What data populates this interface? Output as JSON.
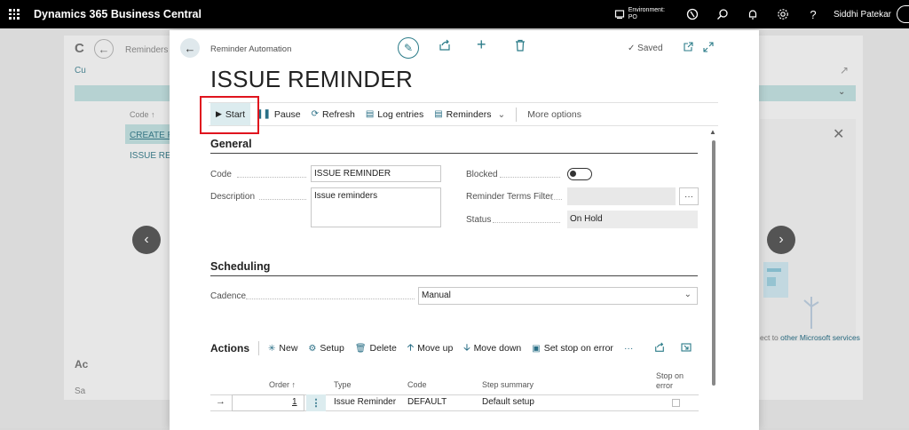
{
  "topbar": {
    "app_title": "Dynamics 365 Business Central",
    "environment_label": "Environment:",
    "environment_value": "PO",
    "user_name": "Siddhi Patekar"
  },
  "background": {
    "breadcrumb": "Reminders A",
    "c_letter": "C",
    "cu_text": "Cu",
    "col_code": "Code ↑",
    "row1": "CREATE RE",
    "row2": "ISSUE REM",
    "side_ac": "Ac",
    "side_sa": "Sa",
    "link_prefix": "ect to",
    "link_text": "other Microsoft services"
  },
  "dialog": {
    "breadcrumb": "Reminder Automation",
    "saved": "Saved",
    "title": "ISSUE REMINDER",
    "actions": {
      "start": "Start",
      "pause": "Pause",
      "refresh": "Refresh",
      "log_entries": "Log entries",
      "reminders": "Reminders",
      "more_options": "More options"
    },
    "general": {
      "title": "General",
      "code_label": "Code",
      "code_value": "ISSUE REMINDER",
      "description_label": "Description",
      "description_value": "Issue reminders",
      "blocked_label": "Blocked",
      "blocked_value": false,
      "terms_filter_label": "Reminder Terms Filter",
      "terms_filter_value": "",
      "status_label": "Status",
      "status_value": "On Hold"
    },
    "scheduling": {
      "title": "Scheduling",
      "cadence_label": "Cadence",
      "cadence_value": "Manual"
    },
    "actions_part": {
      "title": "Actions",
      "new": "New",
      "setup": "Setup",
      "delete": "Delete",
      "move_up": "Move up",
      "move_down": "Move down",
      "set_stop": "Set stop on error",
      "columns": {
        "order": "Order ↑",
        "type": "Type",
        "code": "Code",
        "step_summary": "Step summary",
        "stop_on_error_1": "Stop on",
        "stop_on_error_2": "error"
      },
      "rows": [
        {
          "order": "1",
          "type": "Issue Reminder",
          "code": "DEFAULT",
          "step_summary": "Default setup",
          "stop_on_error": false
        }
      ]
    }
  },
  "colors": {
    "accent": "#2a7b88",
    "highlight": "#e0141e",
    "selected_bg": "#dcecef"
  }
}
